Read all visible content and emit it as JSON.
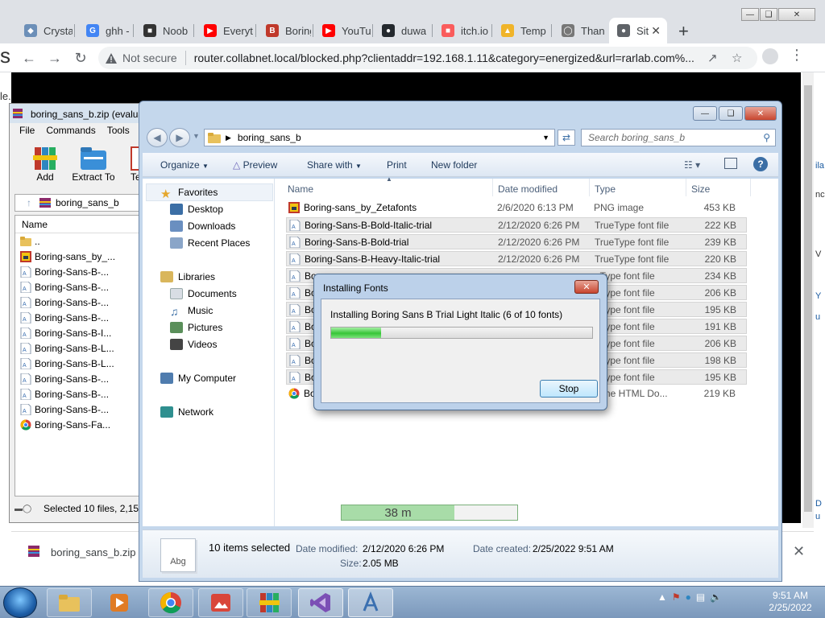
{
  "browser": {
    "tabs": [
      {
        "label": "Crysta",
        "icon": "crystal-icon"
      },
      {
        "label": "ghh -",
        "icon": "google-icon"
      },
      {
        "label": "Noob",
        "icon": "game-icon"
      },
      {
        "label": "Everyt",
        "icon": "youtube-icon"
      },
      {
        "label": "Boring",
        "icon": "font-icon"
      },
      {
        "label": "YouTu",
        "icon": "youtube-icon"
      },
      {
        "label": "duwa",
        "icon": "github-icon"
      },
      {
        "label": "itch.io",
        "icon": "itch-icon"
      },
      {
        "label": "Temp",
        "icon": "temp-icon"
      },
      {
        "label": "Thank",
        "icon": "loading-icon"
      },
      {
        "label": "Sit",
        "icon": "globe-icon"
      }
    ],
    "not_secure": "Not secure",
    "url": "router.collabnet.local/blocked.php?clientaddr=192.168.1.11&category=energized&url=rarlab.com%...",
    "page_left_text": "s",
    "page_left_text2": "le.",
    "page_right_letters": [
      "ila",
      "nc",
      "V",
      "Y",
      "u",
      "D",
      "u"
    ],
    "download_file": "boring_sans_b.zip"
  },
  "winrar": {
    "title": "boring_sans_b.zip (evalua",
    "menu": [
      "File",
      "Commands",
      "Tools"
    ],
    "toolbar": [
      "Add",
      "Extract To",
      "Te"
    ],
    "path": "boring_sans_b",
    "column_name": "Name",
    "files": [
      {
        "name": "..",
        "icon": "folder"
      },
      {
        "name": "Boring-sans_by_...",
        "icon": "png"
      },
      {
        "name": "Boring-Sans-B-...",
        "icon": "font"
      },
      {
        "name": "Boring-Sans-B-...",
        "icon": "font"
      },
      {
        "name": "Boring-Sans-B-...",
        "icon": "font"
      },
      {
        "name": "Boring-Sans-B-...",
        "icon": "font"
      },
      {
        "name": "Boring-Sans-B-I...",
        "icon": "font"
      },
      {
        "name": "Boring-Sans-B-L...",
        "icon": "font"
      },
      {
        "name": "Boring-Sans-B-L...",
        "icon": "font"
      },
      {
        "name": "Boring-Sans-B-...",
        "icon": "font"
      },
      {
        "name": "Boring-Sans-B-...",
        "icon": "font"
      },
      {
        "name": "Boring-Sans-B-...",
        "icon": "font"
      },
      {
        "name": "Boring-Sans-Fa...",
        "icon": "chrome"
      }
    ],
    "status": "Selected 10 files, 2,15"
  },
  "explorer": {
    "address": "boring_sans_b",
    "search_placeholder": "Search boring_sans_b",
    "commands": [
      "Organize",
      "Preview",
      "Share with",
      "Print",
      "New folder"
    ],
    "nav": {
      "favorites": "Favorites",
      "favorites_items": [
        "Desktop",
        "Downloads",
        "Recent Places"
      ],
      "libraries": "Libraries",
      "libraries_items": [
        "Documents",
        "Music",
        "Pictures",
        "Videos"
      ],
      "computer": "My Computer",
      "network": "Network"
    },
    "columns": [
      "Name",
      "Date modified",
      "Type",
      "Size"
    ],
    "files": [
      {
        "name": "Boring-sans_by_Zetafonts",
        "date": "2/6/2020 6:13 PM",
        "type": "PNG image",
        "size": "453 KB",
        "icon": "png",
        "sel": false
      },
      {
        "name": "Boring-Sans-B-Bold-Italic-trial",
        "date": "2/12/2020 6:26 PM",
        "type": "TrueType font file",
        "size": "222 KB",
        "icon": "font",
        "sel": true
      },
      {
        "name": "Boring-Sans-B-Bold-trial",
        "date": "2/12/2020 6:26 PM",
        "type": "TrueType font file",
        "size": "239 KB",
        "icon": "font",
        "sel": true
      },
      {
        "name": "Boring-Sans-B-Heavy-Italic-trial",
        "date": "2/12/2020 6:26 PM",
        "type": "TrueType font file",
        "size": "220 KB",
        "icon": "font",
        "sel": true
      },
      {
        "name": "Bo",
        "date": "",
        "type": "eType font file",
        "size": "234 KB",
        "icon": "font",
        "sel": true
      },
      {
        "name": "Bo",
        "date": "",
        "type": "eType font file",
        "size": "206 KB",
        "icon": "font",
        "sel": true
      },
      {
        "name": "Bo",
        "date": "",
        "type": "eType font file",
        "size": "195 KB",
        "icon": "font",
        "sel": true
      },
      {
        "name": "Bo",
        "date": "",
        "type": "eType font file",
        "size": "191 KB",
        "icon": "font",
        "sel": true
      },
      {
        "name": "Bo",
        "date": "",
        "type": "eType font file",
        "size": "206 KB",
        "icon": "font",
        "sel": true
      },
      {
        "name": "Bo",
        "date": "",
        "type": "eType font file",
        "size": "198 KB",
        "icon": "font",
        "sel": true
      },
      {
        "name": "Bo",
        "date": "",
        "type": "eType font file",
        "size": "195 KB",
        "icon": "font",
        "sel": true
      },
      {
        "name": "Bo",
        "date": "",
        "type": "rome HTML Do...",
        "size": "219 KB",
        "icon": "chrome",
        "sel": false
      }
    ],
    "details": {
      "thumb_label": "Abg",
      "selected": "10 items selected",
      "date_modified_label": "Date modified:",
      "date_modified": "2/12/2020 6:26 PM",
      "date_created_label": "Date created:",
      "date_created": "2/25/2022 9:51 AM",
      "size_label": "Size:",
      "size": "2.05 MB"
    }
  },
  "dialog": {
    "title": "Installing Fonts",
    "message": "Installing Boring Sans B Trial Light Italic (6 of 10 fonts)",
    "progress": 0.19,
    "stop_label": "Stop"
  },
  "minibar": {
    "text": "38 m",
    "progress": 0.64
  },
  "taskbar": {
    "time": "9:51 AM",
    "date": "2/25/2022"
  }
}
